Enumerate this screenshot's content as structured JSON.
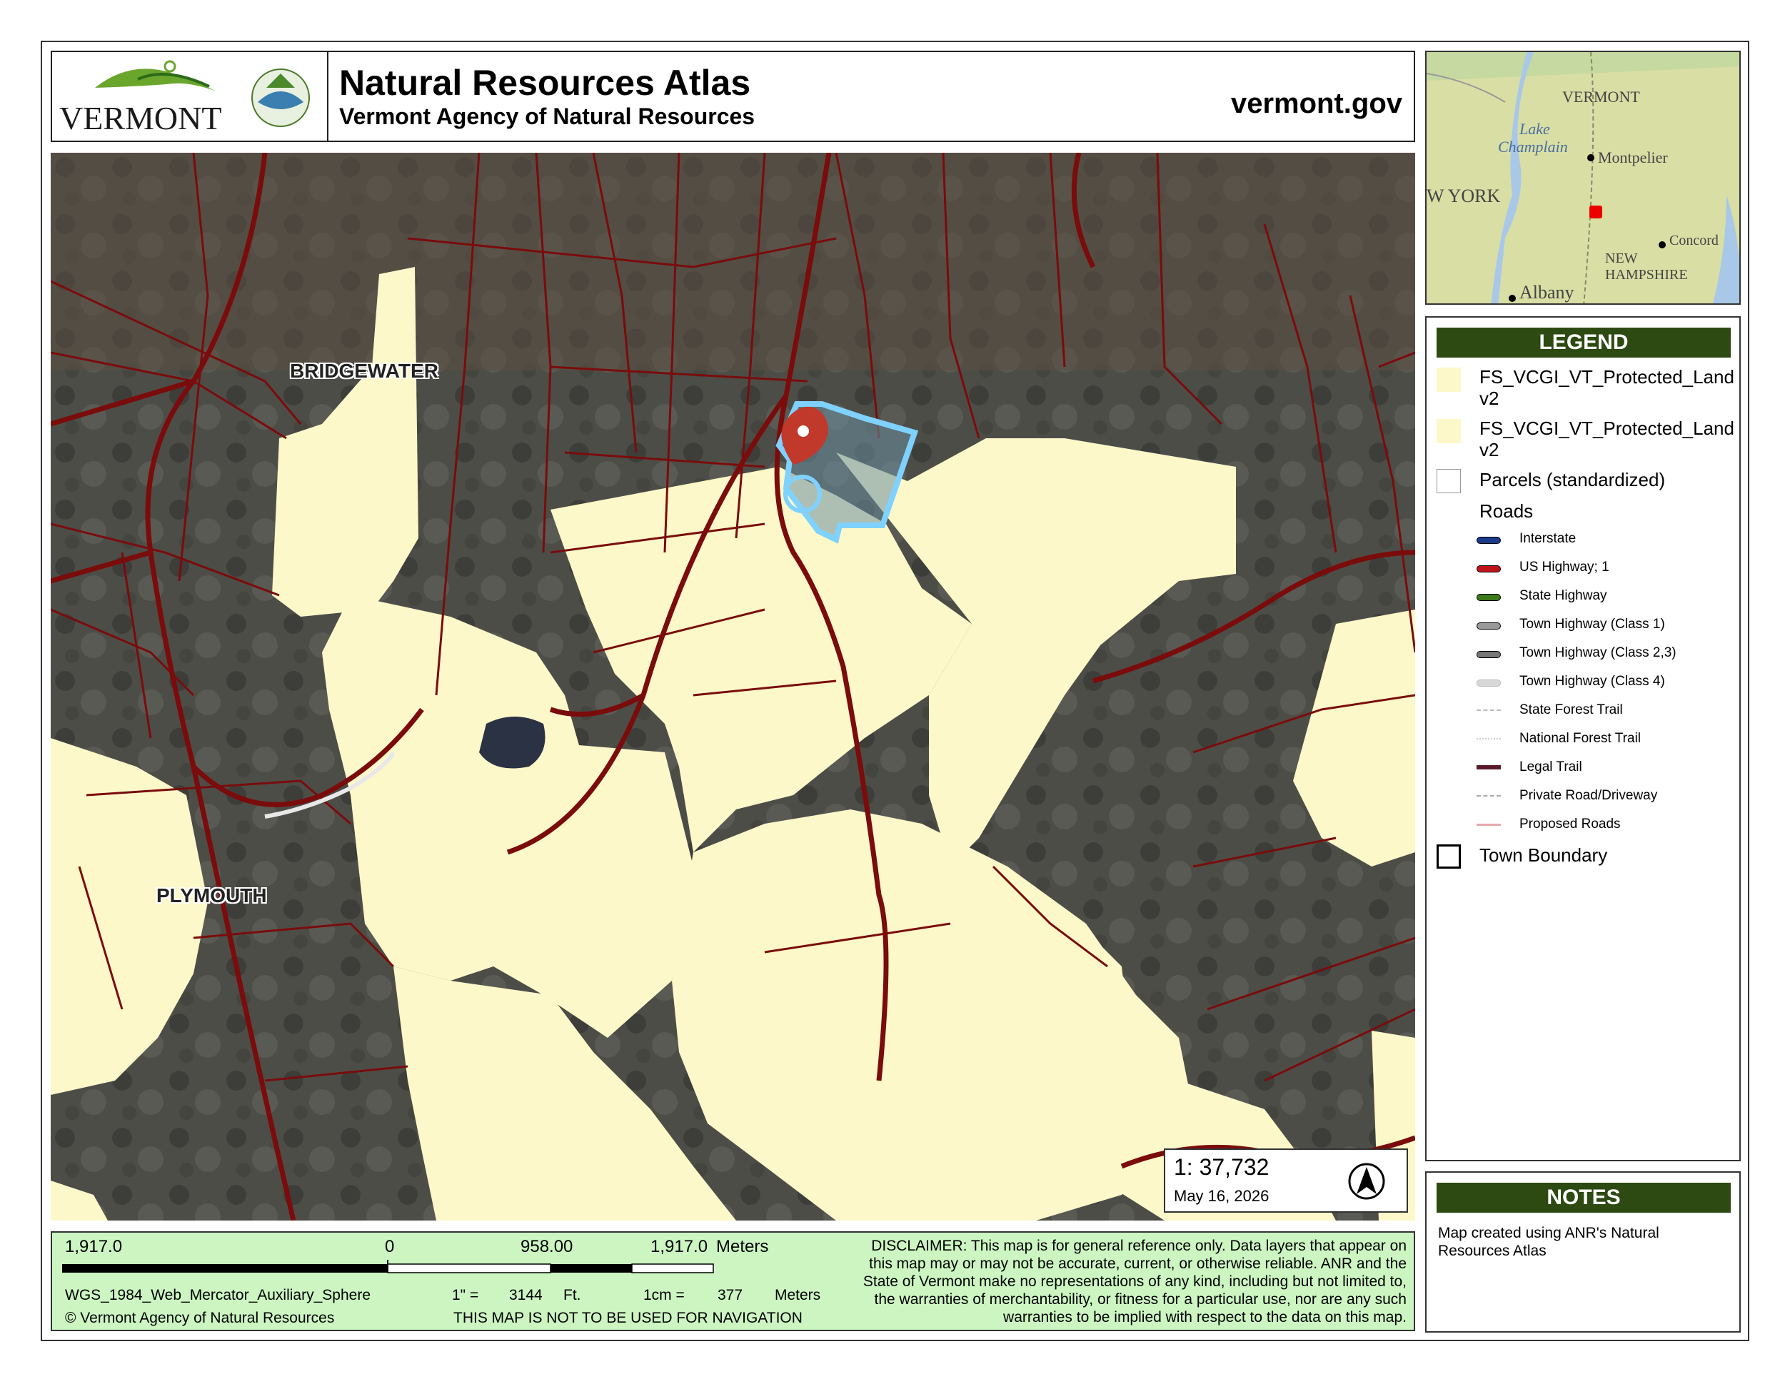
{
  "header": {
    "logo_text": "VERMONT",
    "title": "Natural Resources Atlas",
    "subtitle": "Vermont Agency of Natural Resources",
    "site": "vermont.gov"
  },
  "map": {
    "town_labels": [
      "BRIDGEWATER",
      "PLYMOUTH"
    ],
    "colors": {
      "protected_land": "#fdf8c9",
      "parcel_lines": "#7a0c0c",
      "selected_parcel": "#7fd2ff",
      "marker": "#c0392b"
    }
  },
  "scale_box": {
    "ratio": "1:  37,732",
    "date": "May 16, 2026",
    "north_arrow": "north-arrow-icon"
  },
  "footer": {
    "scale_left": "1,917.0",
    "scale_zero": "0",
    "scale_mid": "958.00",
    "scale_right": "1,917.0",
    "scale_units": "Meters",
    "projection": "WGS_1984_Web_Mercator_Auxiliary_Sphere",
    "copyright": "© Vermont Agency of Natural Resources",
    "inch_label": "1\" =",
    "inch_value": "3144",
    "inch_unit": "Ft.",
    "cm_label": "1cm =",
    "cm_value": "377",
    "cm_unit": "Meters",
    "navigation_warning": "THIS MAP IS NOT TO BE USED FOR NAVIGATION",
    "disclaimer": "DISCLAIMER: This map is for general reference only. Data layers that appear on this map may or may not be accurate, current, or otherwise reliable. ANR and the State of Vermont make no representations of any kind, including but not limited to, the warranties of merchantability, or fitness for a particular use, nor are any such warranties to be implied with respect to the data on this map."
  },
  "inset": {
    "labels": [
      "VERMONT",
      "Lake",
      "Champlain",
      "Montpelier",
      "W YORK",
      "Concord",
      "NEW",
      "HAMPSHIRE",
      "Albany"
    ]
  },
  "legend": {
    "title": "LEGEND",
    "layers": [
      {
        "label": "FS_VCGI_VT_Protected_Land",
        "label2": "v2"
      },
      {
        "label": "FS_VCGI_VT_Protected_Land",
        "label2": "v2"
      },
      {
        "label": "Parcels (standardized)"
      }
    ],
    "roads_heading": "Roads",
    "roads": [
      {
        "label": "Interstate",
        "color": "#1a3a8a"
      },
      {
        "label": "US Highway; 1",
        "color": "#c0141c"
      },
      {
        "label": "State Highway",
        "color": "#3d7a1a"
      },
      {
        "label": "Town Highway (Class 1)",
        "color": "#9a9a9a"
      },
      {
        "label": "Town Highway (Class 2,3)",
        "color": "#777777"
      },
      {
        "label": "Town Highway (Class 4)",
        "color": "#d8d8d8"
      },
      {
        "label": "State Forest Trail",
        "color": "#bbbbbb"
      },
      {
        "label": "National Forest Trail",
        "color": "#cccccc"
      },
      {
        "label": "Legal Trail",
        "color": "#5a1a2a"
      },
      {
        "label": "Private Road/Driveway",
        "color": "#aaaaaa"
      },
      {
        "label": "Proposed Roads",
        "color": "#e8a8a8"
      }
    ],
    "town_boundary": "Town Boundary"
  },
  "notes": {
    "title": "NOTES",
    "text": "Map created using ANR's Natural Resources Atlas"
  }
}
